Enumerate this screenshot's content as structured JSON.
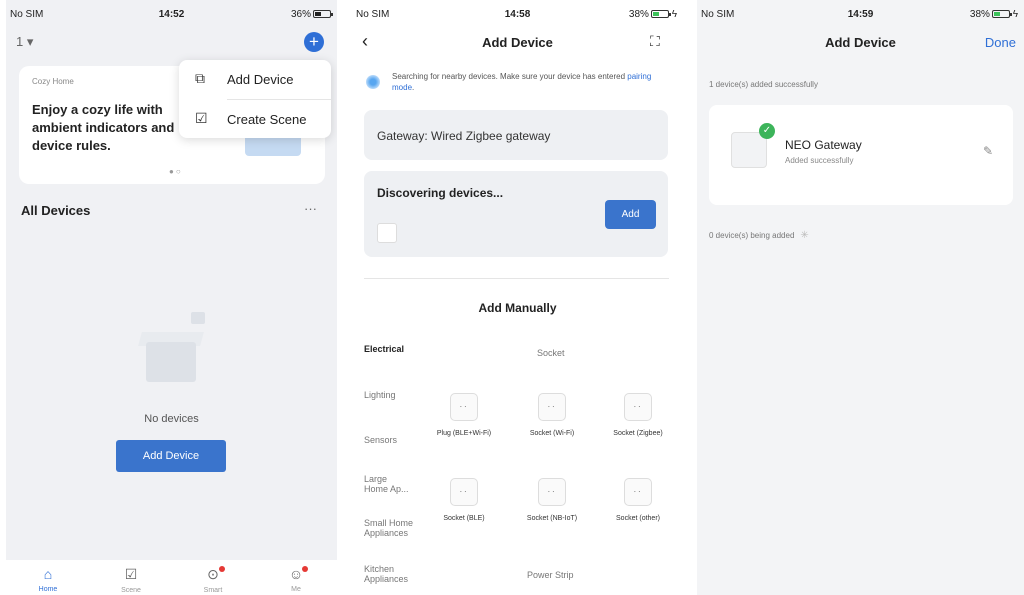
{
  "screen1": {
    "status": {
      "carrier": "No SIM",
      "time": "14:52",
      "battery": "36%"
    },
    "home_selector": "1",
    "banner": {
      "subtitle": "Cozy Home",
      "text": "Enjoy a cozy life with ambient indicators and device rules."
    },
    "menu": {
      "add_device": "Add Device",
      "create_scene": "Create Scene"
    },
    "all_devices": "All Devices",
    "empty_text": "No devices",
    "add_button": "Add Device",
    "tabs": [
      "Home",
      "Scene",
      "Smart",
      "Me"
    ]
  },
  "screen2": {
    "status": {
      "carrier": "No SIM",
      "time": "14:58",
      "battery": "38%"
    },
    "title": "Add Device",
    "search_text": "Searching for nearby devices. Make sure your device has entered",
    "search_link": "pairing mode",
    "search_end": ".",
    "gateway_label": "Gateway: Wired Zigbee gateway",
    "discovering_label": "Discovering devices...",
    "add_small": "Add",
    "add_manually": "Add Manually",
    "categories": [
      "Electrical",
      "Lighting",
      "Sensors",
      "Large Home Ap...",
      "Small Home Appliances",
      "Kitchen Appliances"
    ],
    "section_socket": "Socket",
    "section_power_strip": "Power Strip",
    "devices": [
      {
        "name": "Plug (BLE+Wi-Fi)"
      },
      {
        "name": "Socket (Wi-Fi)"
      },
      {
        "name": "Socket (Zigbee)"
      },
      {
        "name": "Socket (BLE)"
      },
      {
        "name": "Socket (NB-IoT)"
      },
      {
        "name": "Socket (other)"
      }
    ]
  },
  "screen3": {
    "status": {
      "carrier": "No SIM",
      "time": "14:59",
      "battery": "38%"
    },
    "title": "Add Device",
    "done": "Done",
    "added_count": "1 device(s) added successfully",
    "device": {
      "name": "NEO Gateway",
      "status": "Added successfully"
    },
    "adding_count": "0 device(s) being added"
  },
  "colors": {
    "accent": "#3a74cc",
    "success": "#3cb45a",
    "badge": "#e53935"
  }
}
